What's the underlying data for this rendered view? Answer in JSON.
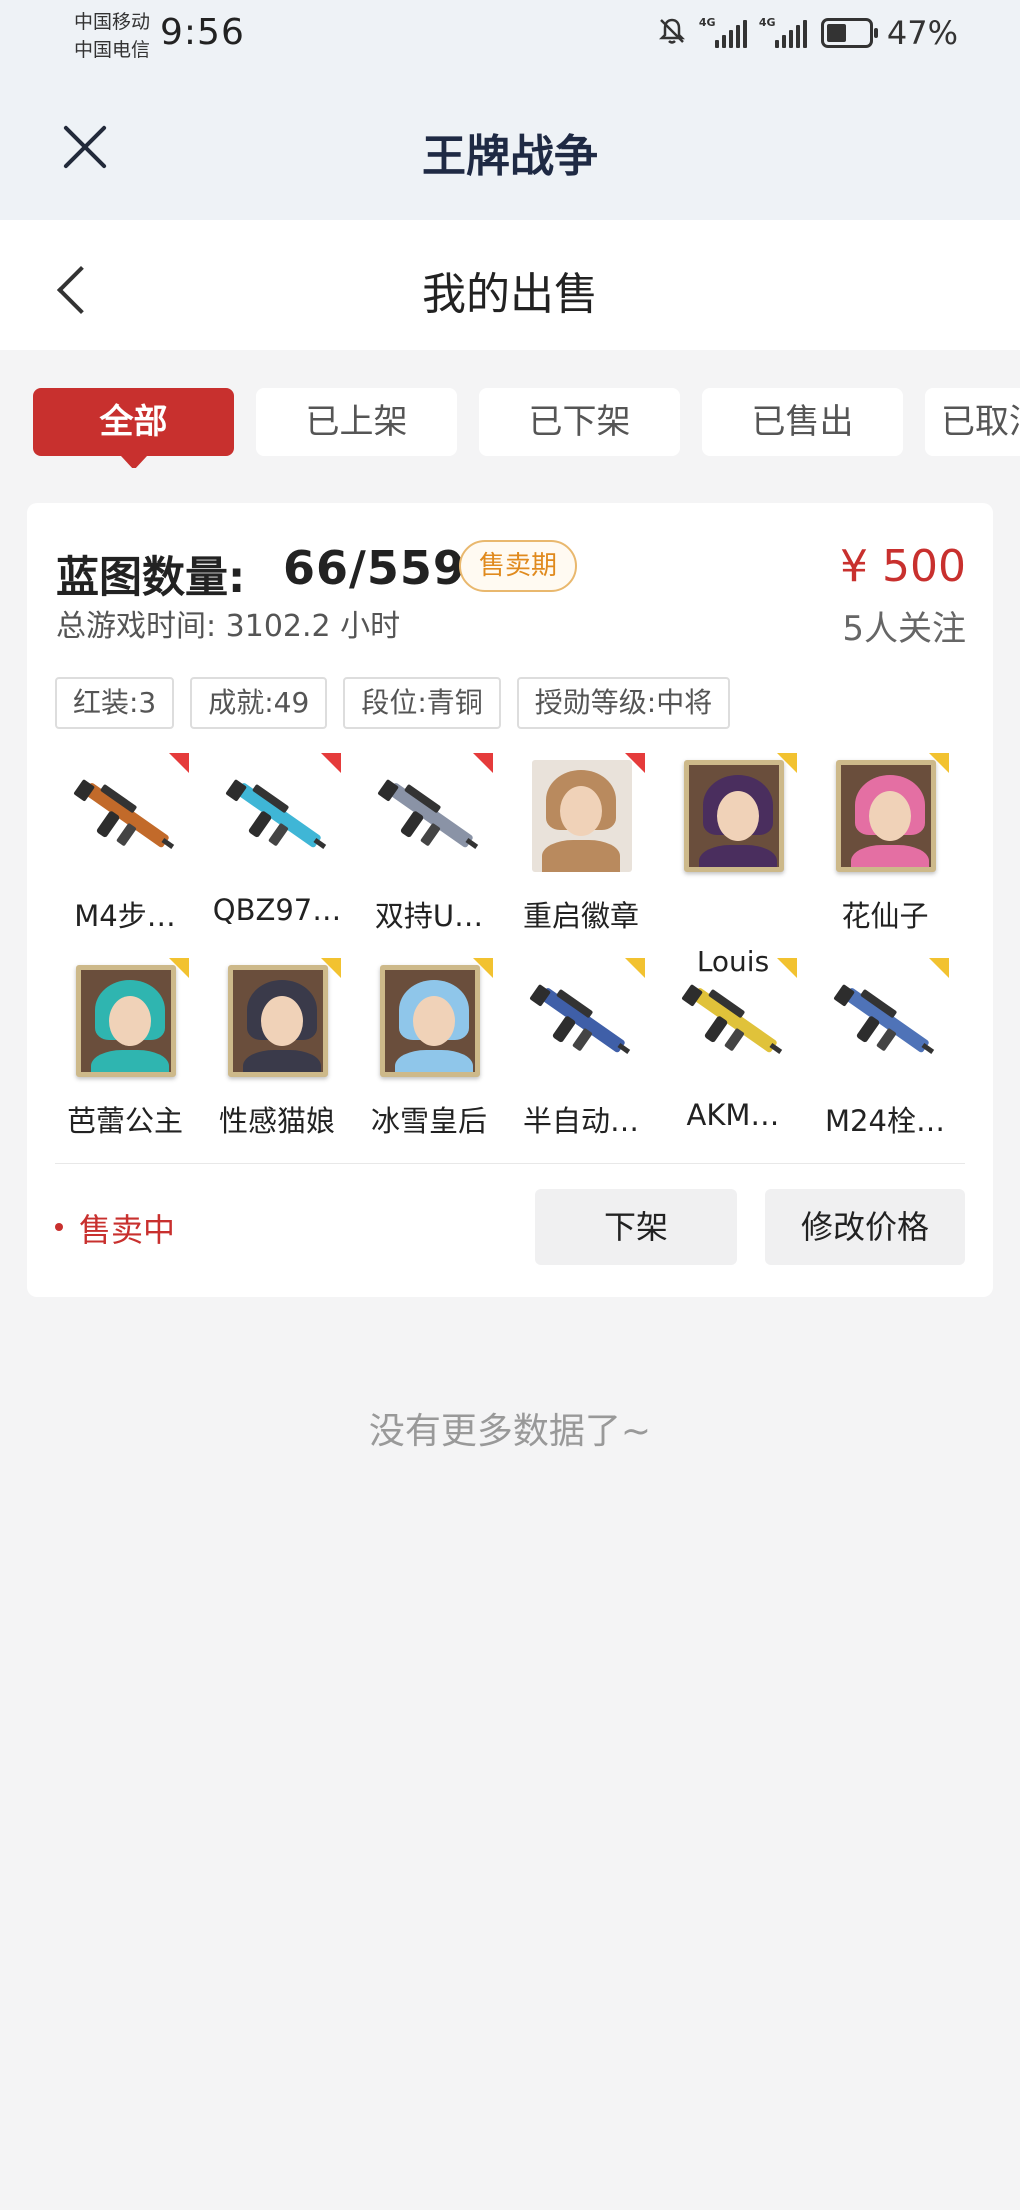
{
  "status_bar": {
    "carrier_1": "中国移动",
    "carrier_2": "中国电信",
    "time": "9:56",
    "network_1": "4G",
    "network_2": "4G",
    "battery": "47%",
    "battery_level": 0.47
  },
  "app": {
    "title": "王牌战争"
  },
  "page": {
    "title": "我的出售"
  },
  "tabs": [
    {
      "label": "全部",
      "active": true
    },
    {
      "label": "已上架",
      "active": false
    },
    {
      "label": "已下架",
      "active": false
    },
    {
      "label": "已售出",
      "active": false
    },
    {
      "label": "已取消",
      "active": false
    }
  ],
  "listing": {
    "blueprint_label": "蓝图数量:",
    "blueprint_count": "66/559",
    "badge": "售卖期",
    "playtime": "总游戏时间:  3102.2 小时",
    "price": "¥ 500",
    "followers": "5人关注",
    "tags": [
      "红装:3",
      "成就:49",
      "段位:青铜",
      "授勋等级:中将"
    ],
    "items": [
      {
        "name": "M4步…",
        "kind": "weapon",
        "corner": "red",
        "color": "#c26a2a"
      },
      {
        "name": "QBZ97…",
        "kind": "weapon",
        "corner": "red",
        "color": "#3fb6d6"
      },
      {
        "name": "双持U…",
        "kind": "weapon",
        "corner": "red",
        "color": "#8a93a6"
      },
      {
        "name": "重启徽章",
        "kind": "portrait-plain",
        "corner": "red",
        "color": "#b98a5e"
      },
      {
        "name": "",
        "kind": "portrait",
        "corner": "gold",
        "color": "#4a2e5e",
        "overlay": "Louis"
      },
      {
        "name": "花仙子",
        "kind": "portrait",
        "corner": "gold",
        "color": "#e46fa3"
      },
      {
        "name": "芭蕾公主",
        "kind": "portrait",
        "corner": "gold",
        "color": "#2fb5b0"
      },
      {
        "name": "性感猫娘",
        "kind": "portrait",
        "corner": "gold",
        "color": "#3a3a4a"
      },
      {
        "name": "冰雪皇后",
        "kind": "portrait",
        "corner": "gold",
        "color": "#8fc6ea"
      },
      {
        "name": "半自动…",
        "kind": "weapon",
        "corner": "gold",
        "color": "#3f5fa8"
      },
      {
        "name": "AKM…",
        "kind": "weapon",
        "corner": "gold",
        "color": "#e0c23a"
      },
      {
        "name": "M24栓…",
        "kind": "weapon",
        "corner": "gold",
        "color": "#4f73b8"
      }
    ],
    "status": "售卖中",
    "delist_label": "下架",
    "edit_price_label": "修改价格"
  },
  "footer": {
    "no_more": "没有更多数据了~"
  }
}
